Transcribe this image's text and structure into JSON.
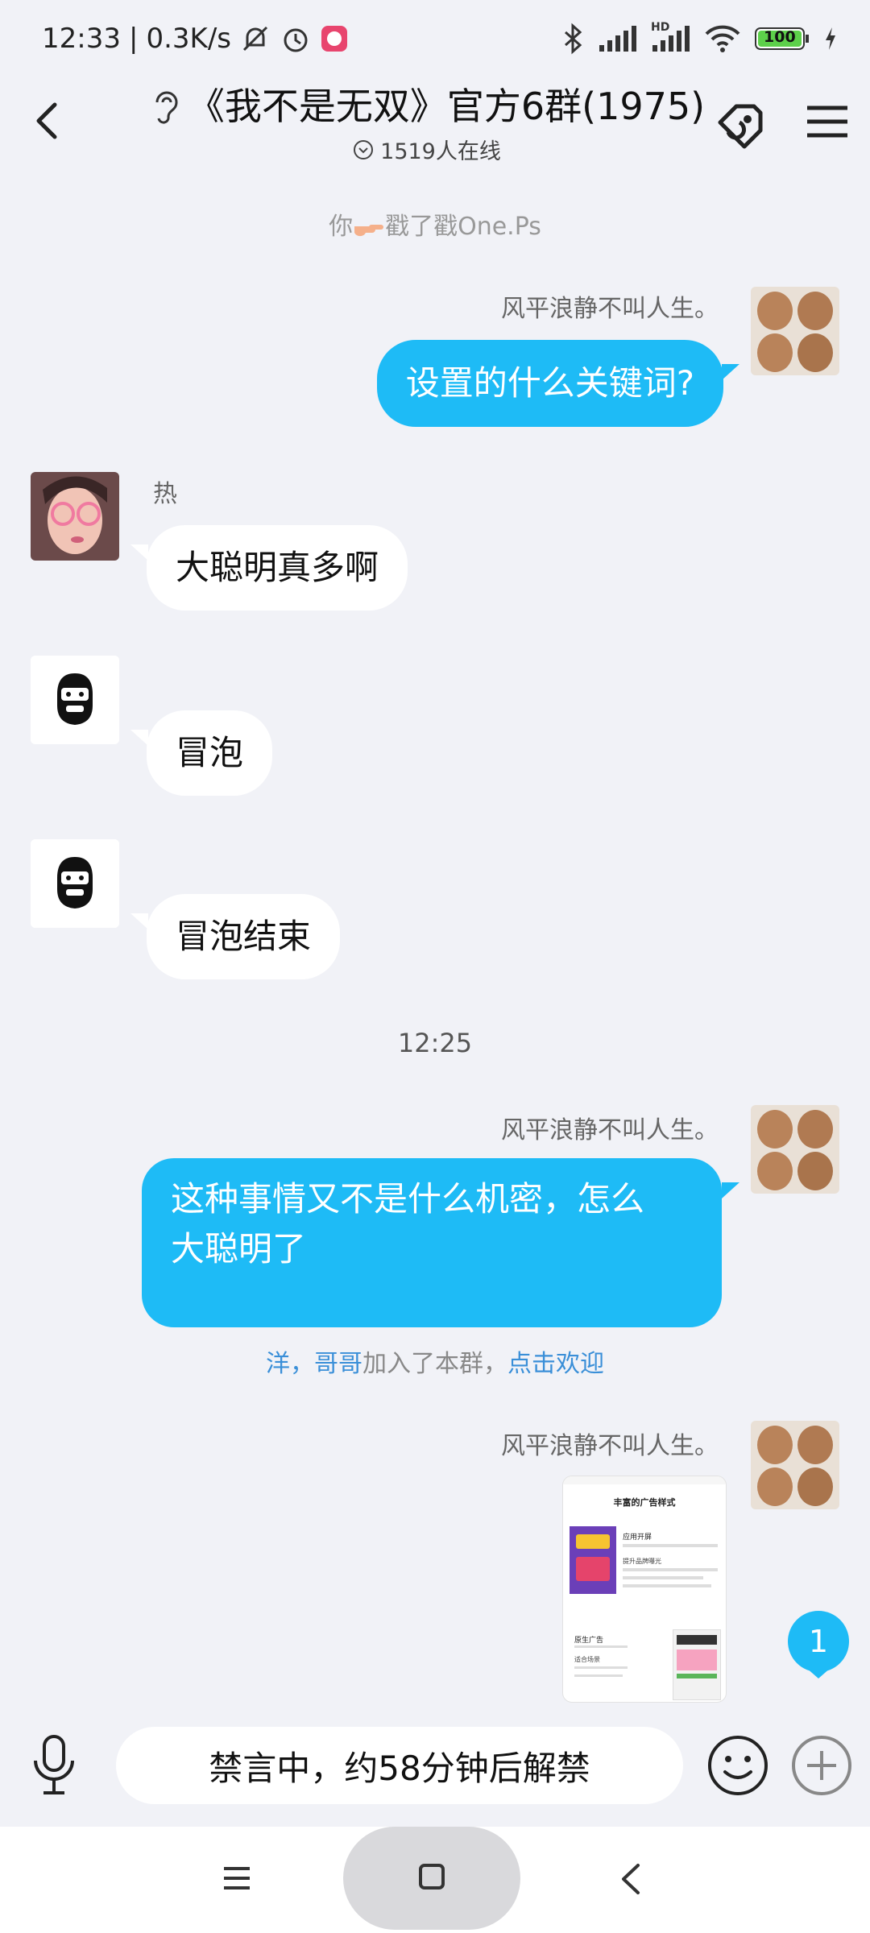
{
  "status_bar": {
    "time": "12:33",
    "speed": "0.3K/s",
    "battery": "100",
    "signal_label": "HD"
  },
  "header": {
    "title": "《我不是无双》官方6群(1975)",
    "online": "1519人在线"
  },
  "messages": {
    "poke": {
      "prefix": "你",
      "suffix": "戳了戳One.Ps"
    },
    "m1": {
      "sender": "风平浪静不叫人生。",
      "text": "设置的什么关键词?"
    },
    "m2": {
      "sender": "热",
      "text": "大聪明真多啊"
    },
    "m3": {
      "text": "冒泡"
    },
    "m4": {
      "text": "冒泡结束"
    },
    "time_sep": "12:25",
    "m5": {
      "sender": "风平浪静不叫人生。",
      "line1": "这种事情又不是什么机密，怎么",
      "line2": "大聪明了"
    },
    "join": {
      "name": "洋，哥哥",
      "middle": "加入了本群，",
      "action": "点击欢迎"
    },
    "m6": {
      "sender": "风平浪静不叫人生。"
    }
  },
  "image_preview": {
    "heading": "丰富的广告样式",
    "item1_title": "应用开屏",
    "item1_sub": "提升品牌曝光",
    "item2_title": "原生广告",
    "item2_sub": "适合场景"
  },
  "unread_badge": "1",
  "input": {
    "placeholder": "禁言中，约58分钟后解禁"
  },
  "colors": {
    "accent": "#1ebbf6",
    "background": "#f1f2f7",
    "link": "#3a8fd8"
  },
  "icons": [
    "back-arrow-icon",
    "ear-icon",
    "chevron-circle-icon",
    "tag-icon",
    "menu-icon",
    "mic-icon",
    "emoji-icon",
    "plus-icon",
    "bluetooth-icon",
    "signal-icon",
    "wifi-icon",
    "battery-icon",
    "alarm-icon",
    "mute-icon"
  ]
}
